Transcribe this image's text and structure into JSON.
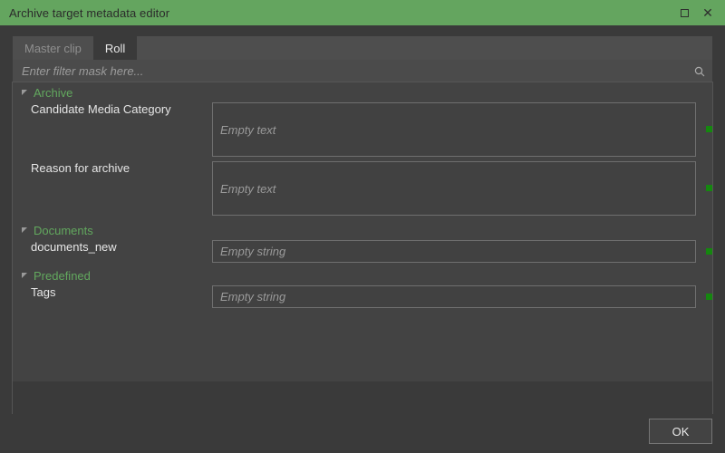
{
  "window": {
    "title": "Archive target metadata editor",
    "titlebar_color": "#64a55f",
    "background_color": "#434343",
    "maximize_icon": "maximize-icon",
    "close_icon": "close-icon",
    "close_glyph": "✕"
  },
  "tabs": [
    {
      "label": "Master clip",
      "active": false
    },
    {
      "label": "Roll",
      "active": true
    }
  ],
  "filter": {
    "value": "",
    "placeholder": "Enter filter mask here...",
    "icon": "search-icon"
  },
  "sections": [
    {
      "title": "Archive",
      "expanded": true,
      "color": "#62a85e",
      "fields": [
        {
          "label": "Candidate Media Category",
          "value": "",
          "placeholder": "Empty text",
          "type": "multiline",
          "status": "ok",
          "status_color": "#15870f"
        },
        {
          "label": "Reason for archive",
          "value": "",
          "placeholder": "Empty text",
          "type": "multiline",
          "status": "ok",
          "status_color": "#15870f"
        }
      ]
    },
    {
      "title": "Documents",
      "expanded": true,
      "color": "#62a85e",
      "fields": [
        {
          "label": "documents_new",
          "value": "",
          "placeholder": "Empty string",
          "type": "singleline",
          "status": "ok",
          "status_color": "#15870f"
        }
      ]
    },
    {
      "title": "Predefined",
      "expanded": true,
      "color": "#62a85e",
      "fields": [
        {
          "label": "Tags",
          "value": "",
          "placeholder": "Empty string",
          "type": "singleline",
          "status": "ok",
          "status_color": "#15870f"
        }
      ]
    }
  ],
  "footer": {
    "ok_label": "OK"
  }
}
